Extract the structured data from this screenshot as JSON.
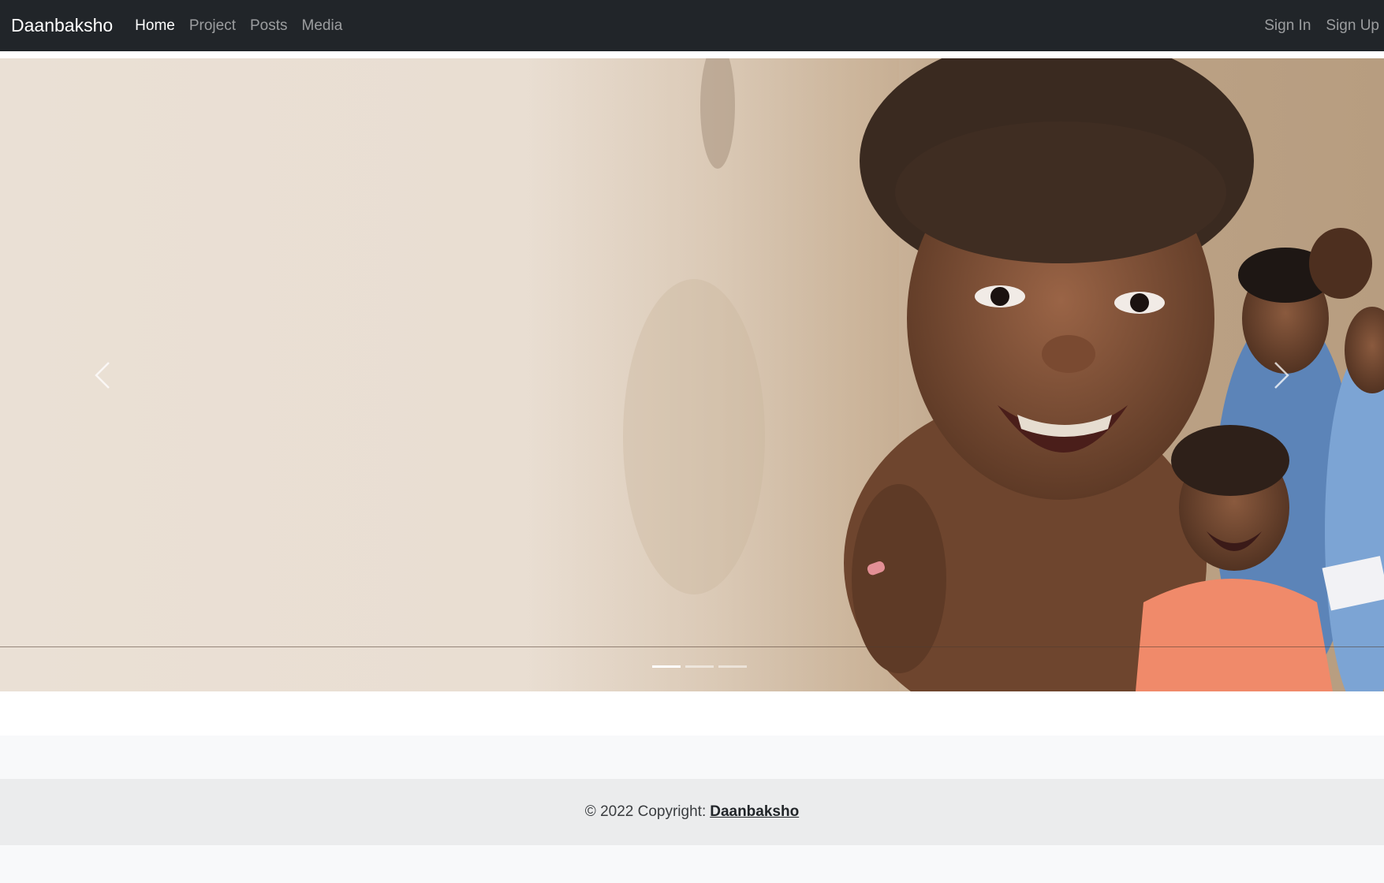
{
  "navbar": {
    "brand": "Daanbaksho",
    "links": [
      {
        "label": "Home",
        "active": true
      },
      {
        "label": "Project",
        "active": false
      },
      {
        "label": "Posts",
        "active": false
      },
      {
        "label": "Media",
        "active": false
      }
    ],
    "right_links": [
      {
        "label": "Sign In"
      },
      {
        "label": "Sign Up"
      }
    ]
  },
  "carousel": {
    "slide_count": 3,
    "active_slide": 1,
    "prev_icon": "chevron-left-icon",
    "next_icon": "chevron-right-icon"
  },
  "footer": {
    "copyright": "© 2022 Copyright:",
    "link_label": "Daanbaksho"
  },
  "colors": {
    "navbar_bg": "#212529",
    "footer_bg": "#ebeced",
    "light_band": "#f8f9fa"
  }
}
